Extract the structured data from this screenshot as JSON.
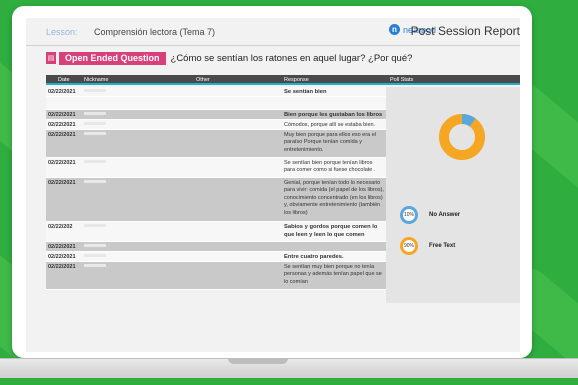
{
  "header": {
    "lesson_label": "Lesson:",
    "lesson_name": "Comprensión lectora (Tema 7)",
    "brand_name": "nearpod",
    "report_title": "Post Session Report"
  },
  "question": {
    "type_label": "Open Ended Question",
    "text": "¿Cómo se sentían los ratones en aquel lugar? ¿Por qué?"
  },
  "table": {
    "columns": [
      "Date",
      "Nickname",
      "Other",
      "Response",
      "Poll Stats"
    ],
    "rows": [
      {
        "date": "02/22/2021",
        "response": "Se sentían bien",
        "bold": true
      },
      {
        "date": "02/22/2021",
        "response": "Bien porque les gustaban los libros",
        "bold": true
      },
      {
        "date": "02/22/2021",
        "response": "Cómodos, porque allí se estaba bien.",
        "bold": false
      },
      {
        "date": "02/22/2021",
        "response": "Muy bien porque para ellos eso era el paraíso  Porque tenían comida y entretenimiento.",
        "bold": false
      },
      {
        "date": "02/22/2021",
        "response": "Se sentían bien porque tenían libros para comer como si fuese chocolate .",
        "bold": false
      },
      {
        "date": "02/22/2021",
        "response": "Genial, porque tenían todo lo necesario para vivir: comida (el papel de los libros), conocimiento concentrado (en los libros) y, obviamente entretenimiento (también los libros)",
        "bold": false
      },
      {
        "date": "02/22/202",
        "response": "Sabios y gordos porque comen lo que leen y leen lo que comen",
        "bold": true
      },
      {
        "date": "02/22/2021",
        "response": "",
        "bold": false
      },
      {
        "date": "02/22/2021",
        "response": "Entre cuatro paredes.",
        "bold": true
      },
      {
        "date": "02/22/2021",
        "response": "Se sentían muy bien porque no tenía personas y además tenían papel que se lo comían",
        "bold": false
      }
    ]
  },
  "poll": {
    "no_answer_pct": "10%",
    "no_answer_label": "No Answer",
    "no_answer_fraction": 0.1,
    "free_text_pct": "90%",
    "free_text_label": "Free Text",
    "free_text_fraction": 0.9,
    "colors": {
      "no_answer": "#5aa7e0",
      "free_text": "#f5a623"
    }
  },
  "colors": {
    "accent": "#d8407a",
    "header_rule": "#21b1c7",
    "brand": "#2a7fd5"
  }
}
